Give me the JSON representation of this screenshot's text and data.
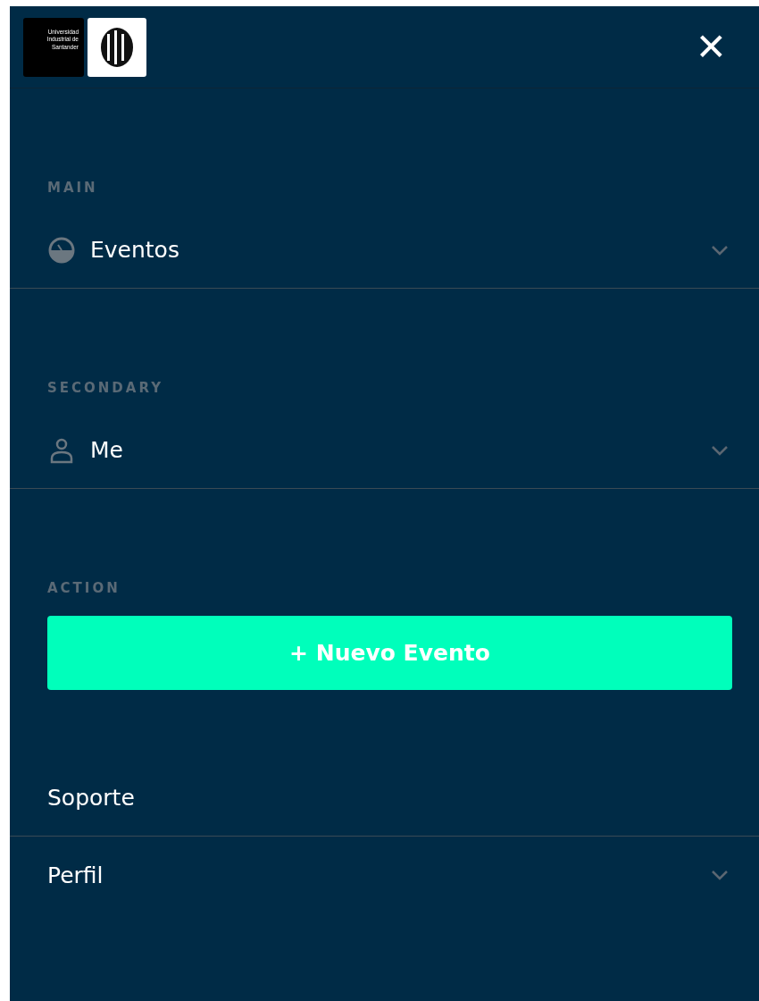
{
  "header": {
    "logo_text": "Universidad Industrial de Santander",
    "close": "✕"
  },
  "sections": [
    {
      "label": "MAIN",
      "items": [
        {
          "label": "Eventos",
          "kind": "gauge",
          "expandable": true
        }
      ]
    },
    {
      "label": "SECONDARY",
      "items": [
        {
          "label": "Me",
          "kind": "person",
          "expandable": true
        }
      ]
    },
    {
      "label": "ACTION",
      "button": "+ Nuevo Evento"
    }
  ],
  "links": [
    {
      "label": "Soporte",
      "expandable": false,
      "divider": true
    },
    {
      "label": "Perfil",
      "expandable": true,
      "divider": false
    }
  ]
}
